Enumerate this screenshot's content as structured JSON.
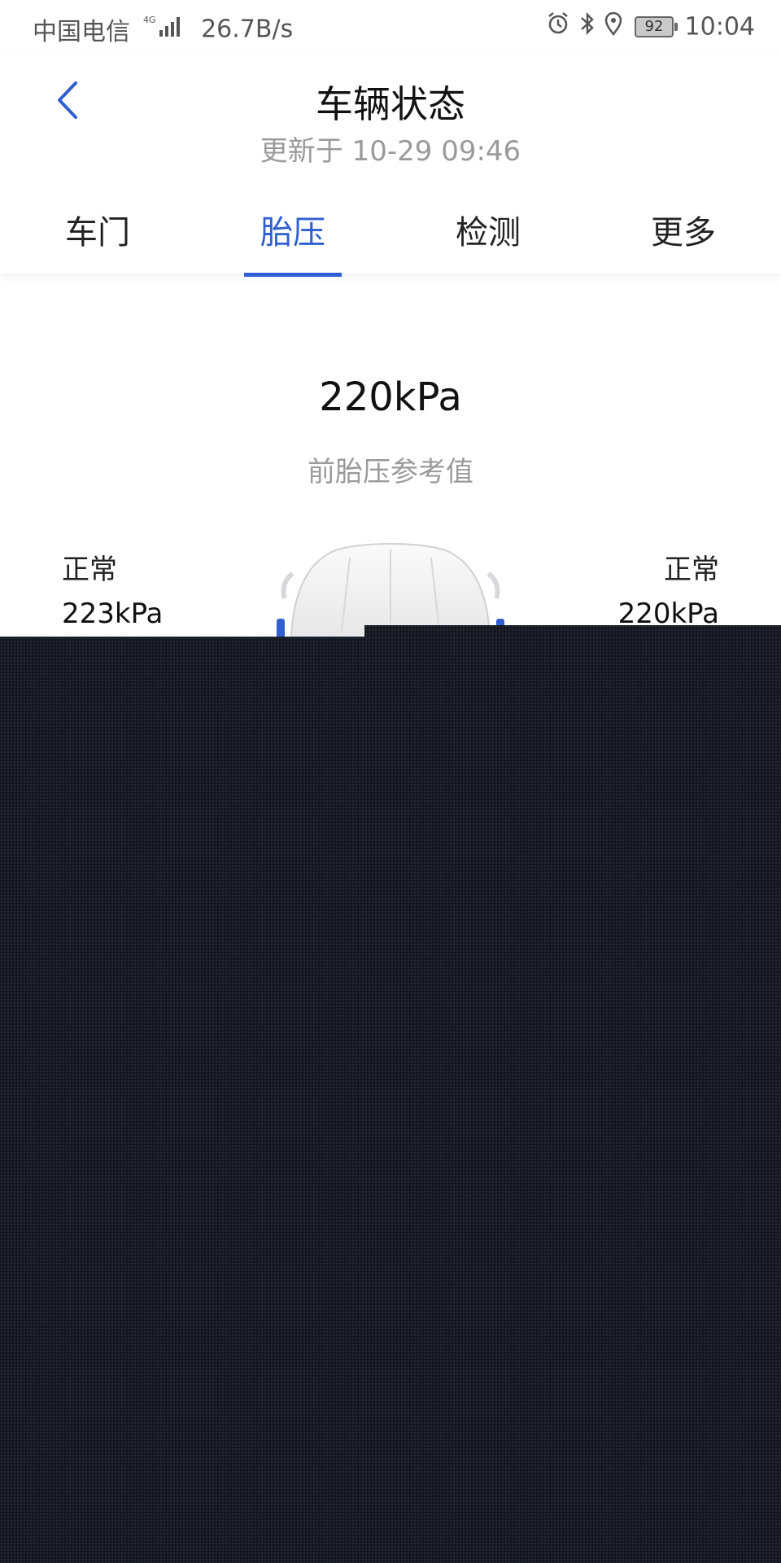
{
  "status_bar": {
    "carrier": "中国电信",
    "network": "4G",
    "speed": "26.7B/s",
    "battery": "92",
    "time": "10:04"
  },
  "header": {
    "title": "车辆状态",
    "subtitle": "更新于 10-29 09:46"
  },
  "tabs": [
    {
      "label": "车门",
      "active": false
    },
    {
      "label": "胎压",
      "active": true
    },
    {
      "label": "检测",
      "active": false
    },
    {
      "label": "更多",
      "active": false
    }
  ],
  "tire": {
    "front_reference_value": "220kPa",
    "front_reference_label": "前胎压参考值",
    "front_left": {
      "status": "正常",
      "pressure": "223kPa"
    },
    "front_right": {
      "status": "正常",
      "pressure": "220kPa"
    }
  },
  "colors": {
    "accent": "#2f5fd0",
    "overlay": "#131720"
  }
}
